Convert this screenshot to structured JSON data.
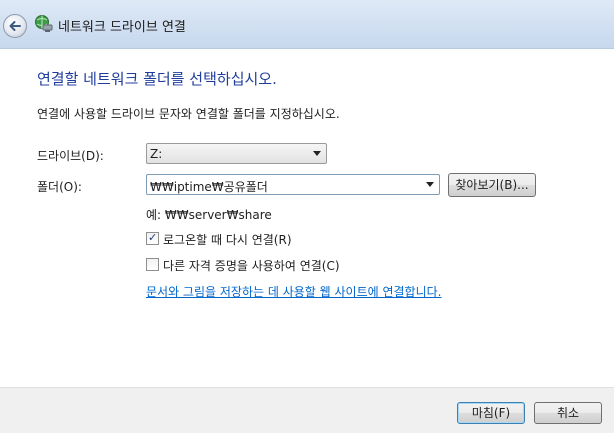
{
  "window": {
    "title": "네트워크 드라이브 연결",
    "back_icon": "back-arrow-icon",
    "title_icon": "network-drive-icon"
  },
  "main": {
    "heading": "연결할 네트워크 폴더를 선택하십시오.",
    "instruction": "연결에 사용할 드라이브 문자와 연결할 폴더를 지정하십시오.",
    "drive_label": "드라이브(D):",
    "drive_value": "Z:",
    "folder_label": "폴더(O):",
    "folder_value": "₩₩iptime₩공유폴더",
    "browse_label": "찾아보기(B)...",
    "example": "예: ₩₩server₩share",
    "reconnect_label": "로그온할 때 다시 연결(R)",
    "reconnect_checked": true,
    "other_credentials_label": "다른 자격 증명을 사용하여 연결(C)",
    "other_credentials_checked": false,
    "link_text": "문서와 그림을 저장하는 데 사용할 웹 사이트에 연결합니다."
  },
  "footer": {
    "finish_label": "마침(F)",
    "cancel_label": "취소"
  },
  "colors": {
    "heading": "#1f3c9c",
    "link": "#0066cc",
    "titlebar": "#d3e1f2"
  }
}
